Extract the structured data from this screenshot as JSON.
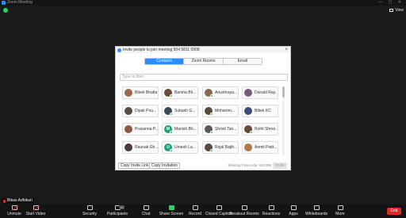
{
  "window": {
    "title": "Zoom Meeting",
    "controls": "— ▢ ✕"
  },
  "view": {
    "label": "View"
  },
  "dialog": {
    "title": "Invite people to join meeting 504 5811 0908",
    "tabs": [
      "Contacts",
      "Zoom Rooms",
      "Email"
    ],
    "active_tab": 0,
    "filter_placeholder": "Type to filter",
    "contacts": [
      {
        "name": "Bibek Bhatta",
        "color": "#9b6a4a",
        "initial": "",
        "online": false
      },
      {
        "name": "Barsha Bh...",
        "color": "#6b4a3a",
        "initial": "",
        "online": true
      },
      {
        "name": "Anushraya...",
        "color": "#8a6a54",
        "initial": "",
        "online": true
      },
      {
        "name": "Donald Ray...",
        "color": "#7a5a7a",
        "initial": "",
        "online": false
      },
      {
        "name": "Dipak Pou...",
        "color": "#5a4a44",
        "initial": "",
        "online": false
      },
      {
        "name": "Subash G...",
        "color": "#3a4a5a",
        "initial": "",
        "online": true
      },
      {
        "name": "Mohamm...",
        "color": "#5a4a3a",
        "initial": "",
        "online": true
      },
      {
        "name": "Bibek KC",
        "color": "#3d4d7a",
        "initial": "",
        "online": false
      },
      {
        "name": "Prasanna P...",
        "color": "#8a5a44",
        "initial": "",
        "online": false
      },
      {
        "name": "Manish Bh...",
        "color": "#1aa37a",
        "initial": "M",
        "online": true
      },
      {
        "name": "Shristi Tan...",
        "color": "#5a5a5a",
        "initial": "",
        "online": true
      },
      {
        "name": "Rohit Shres...",
        "color": "#6a4a3a",
        "initial": "",
        "online": true
      },
      {
        "name": "Raunak Gh...",
        "color": "#4a3a3a",
        "initial": "",
        "online": false
      },
      {
        "name": "Umesh La...",
        "color": "#1aa37a",
        "initial": "U",
        "online": true
      },
      {
        "name": "Rojal Bajth...",
        "color": "#5a4a44",
        "initial": "",
        "online": true
      },
      {
        "name": "Anmit Piatt...",
        "color": "#b07a4a",
        "initial": "",
        "online": false
      }
    ],
    "copy_link": "Copy Invite Link",
    "copy_invitation": "Copy Invitation",
    "passcode_label": "Meeting Passcode: 601398",
    "invite_button": "Invite"
  },
  "self": {
    "name": "Bibas Adhikari"
  },
  "toolbar": {
    "items": [
      {
        "label": "Unmute",
        "icon": "mic-off-icon",
        "variant": "red"
      },
      {
        "label": "Start Video",
        "icon": "video-off-icon",
        "variant": "red"
      },
      {
        "label": "Security",
        "icon": "shield-icon",
        "variant": ""
      },
      {
        "label": "Participants",
        "icon": "participants-icon",
        "variant": "",
        "badge": "12"
      },
      {
        "label": "Chat",
        "icon": "chat-icon",
        "variant": ""
      },
      {
        "label": "Share Screen",
        "icon": "share-screen-icon",
        "variant": "green"
      },
      {
        "label": "Record",
        "icon": "record-icon",
        "variant": ""
      },
      {
        "label": "Closed Caption",
        "icon": "cc-icon",
        "variant": ""
      },
      {
        "label": "Breakout Rooms",
        "icon": "breakout-icon",
        "variant": ""
      },
      {
        "label": "Reactions",
        "icon": "reactions-icon",
        "variant": ""
      },
      {
        "label": "Apps",
        "icon": "apps-icon",
        "variant": ""
      },
      {
        "label": "Whiteboards",
        "icon": "whiteboard-icon",
        "variant": ""
      },
      {
        "label": "More",
        "icon": "more-icon",
        "variant": ""
      }
    ],
    "end_label": "End"
  }
}
